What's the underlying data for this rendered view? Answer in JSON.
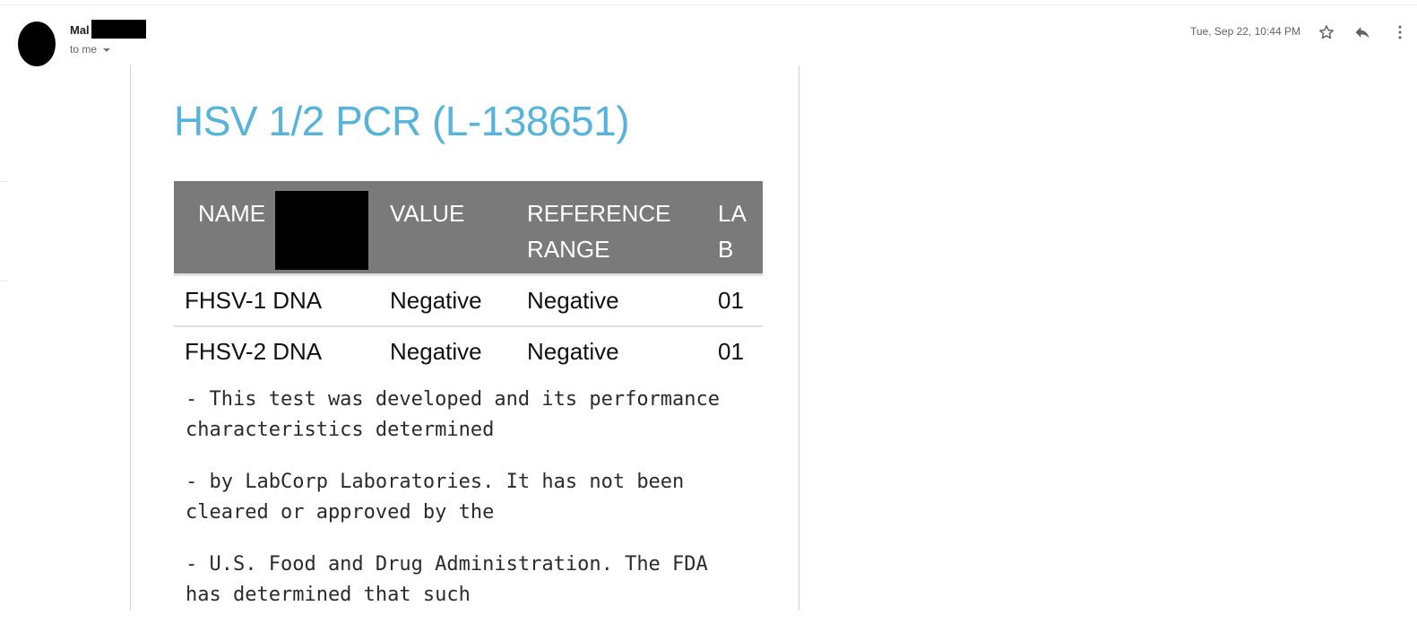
{
  "email": {
    "sender_name_visible": "Mal",
    "recipient_label": "to me",
    "date": "Tue, Sep 22, 10:44 PM",
    "actions": {
      "star_icon": "star-outline-icon",
      "reply_icon": "reply-icon",
      "more_icon": "more-vert-icon"
    }
  },
  "report": {
    "title": "HSV 1/2 PCR (L-138651)",
    "table": {
      "headers": [
        "NAME",
        "VALUE",
        "REFERENCE RANGE",
        "LAB"
      ],
      "header_lines": {
        "name": "NAME",
        "value": "VALUE",
        "reference_1": "REFERENCE",
        "reference_2": "RANGE",
        "lab_1": "LA",
        "lab_2": "B"
      },
      "rows": [
        {
          "name": "FHSV-1 DNA",
          "value": "Negative",
          "reference": "Negative",
          "lab": "01"
        },
        {
          "name": "FHSV-2 DNA",
          "value": "Negative",
          "reference": "Negative",
          "lab": "01"
        }
      ]
    },
    "notes": [
      "- This test was developed and its performance characteristics determined",
      "- by LabCorp Laboratories. It has not been cleared or approved by the",
      "- U.S. Food and Drug Administration. The FDA has determined that such"
    ]
  },
  "colors": {
    "title": "#56b4dc",
    "table_header_bg": "#7a7a7b",
    "frame_border": "#c9d6e8"
  }
}
